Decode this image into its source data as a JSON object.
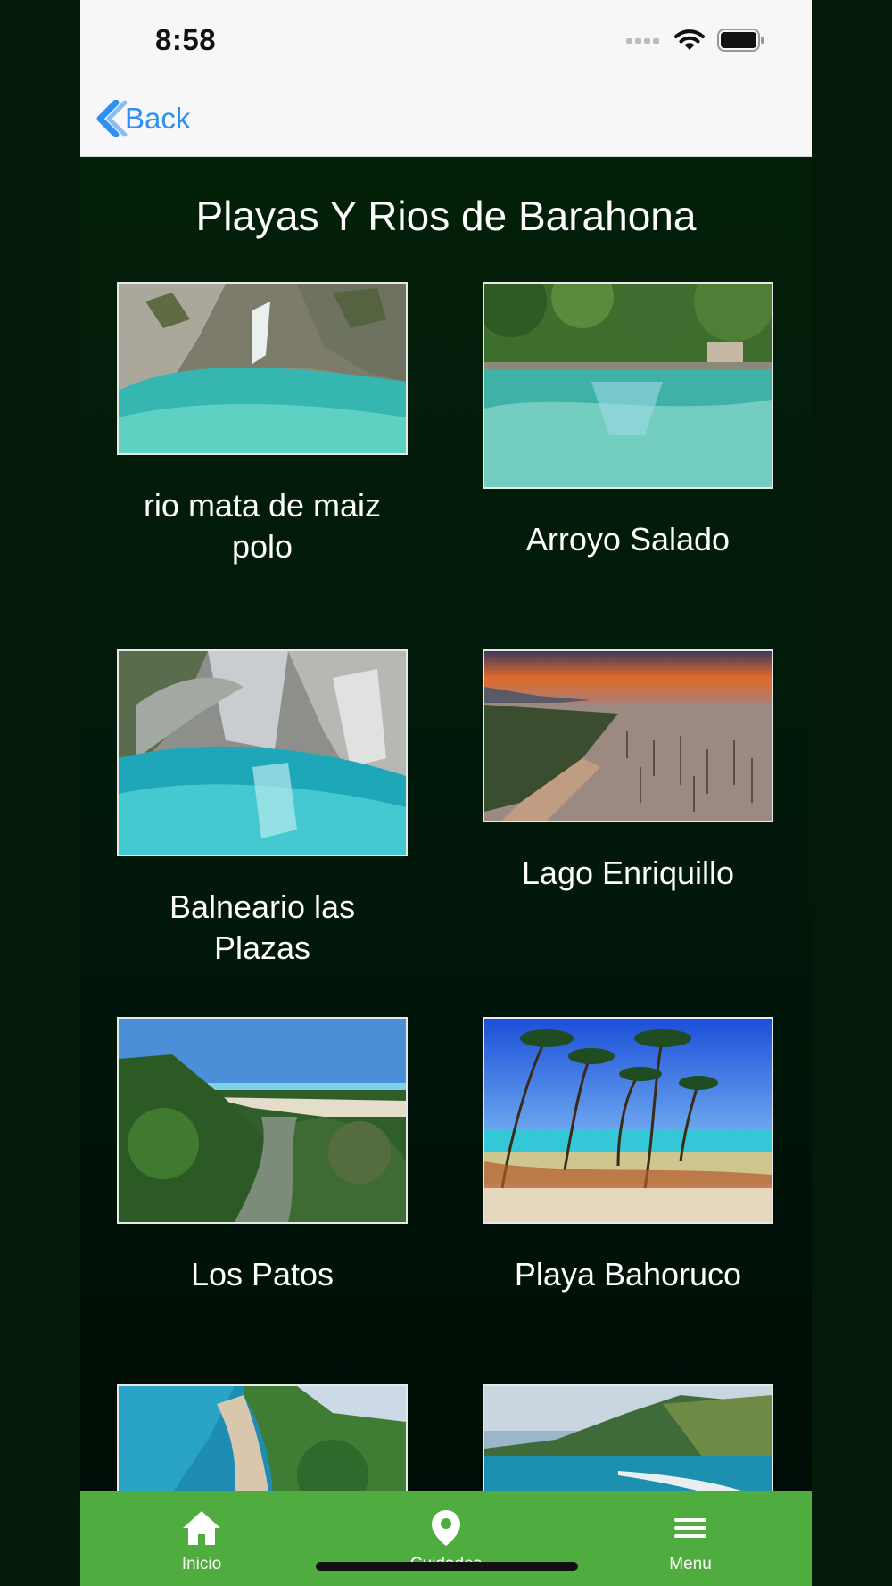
{
  "status_bar": {
    "time": "8:58"
  },
  "nav": {
    "back_label": "Back"
  },
  "page_title": "Playas Y Rios de Barahona",
  "places": [
    {
      "name": "rio mata de maiz polo"
    },
    {
      "name": "Arroyo Salado"
    },
    {
      "name": "Balneario las Plazas"
    },
    {
      "name": "Lago Enriquillo"
    },
    {
      "name": "Los Patos"
    },
    {
      "name": "Playa Bahoruco"
    },
    {
      "name": ""
    },
    {
      "name": ""
    }
  ],
  "tabbar": {
    "items": [
      {
        "label": "Inicio",
        "icon": "home-icon"
      },
      {
        "label": "Cuidades",
        "icon": "map-pin-icon"
      },
      {
        "label": "Menu",
        "icon": "menu-icon"
      }
    ]
  },
  "colors": {
    "background": "#02180a",
    "tabbar": "#4fad3f",
    "accent": "#2f8ff3"
  }
}
